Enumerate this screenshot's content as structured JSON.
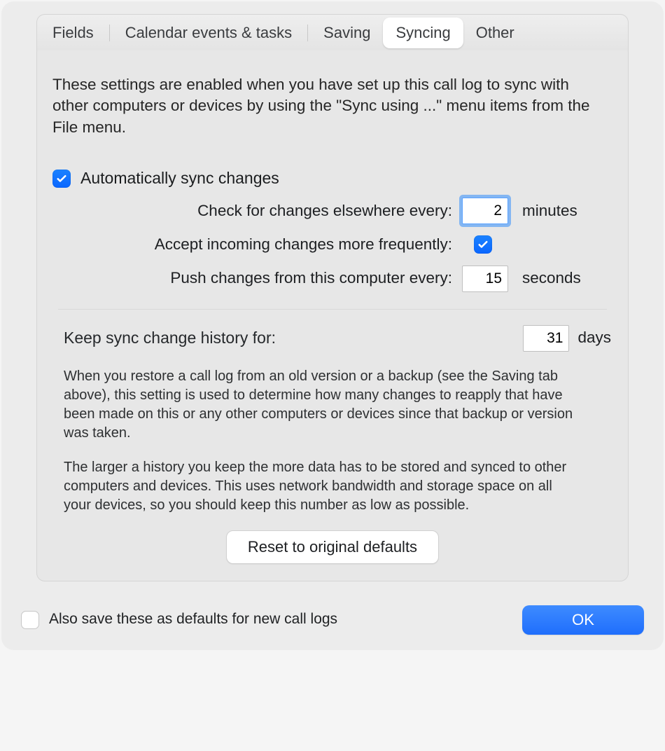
{
  "tabs": {
    "fields": "Fields",
    "calendar": "Calendar events & tasks",
    "saving": "Saving",
    "syncing": "Syncing",
    "other": "Other",
    "active": "syncing"
  },
  "intro": "These settings are enabled when you have set up this call log to sync with other computers or devices by using the \"Sync using ...\" menu items from the File menu.",
  "auto_sync": {
    "label": "Automatically sync changes",
    "checked": true
  },
  "check_every": {
    "label": "Check for changes elsewhere every:",
    "value": "2",
    "unit": "minutes",
    "focused": true
  },
  "accept_more": {
    "label": "Accept incoming changes more frequently:",
    "checked": true
  },
  "push_every": {
    "label": "Push changes from this computer every:",
    "value": "15",
    "unit": "seconds"
  },
  "history": {
    "label": "Keep sync change history for:",
    "value": "31",
    "unit": "days"
  },
  "help1": "When you restore a call log from an old version or a backup (see the Saving tab above), this setting is used to determine how many changes to reapply that have been made on this or any other computers or devices since that backup or version was taken.",
  "help2": "The larger a history you keep the more data has to be stored and synced to other computers and devices. This uses network bandwidth and storage space on all your devices, so you should keep this number as low as possible.",
  "reset_label": "Reset to original defaults",
  "also_default": {
    "label": "Also save these as defaults for new call logs",
    "checked": false
  },
  "ok_label": "OK"
}
